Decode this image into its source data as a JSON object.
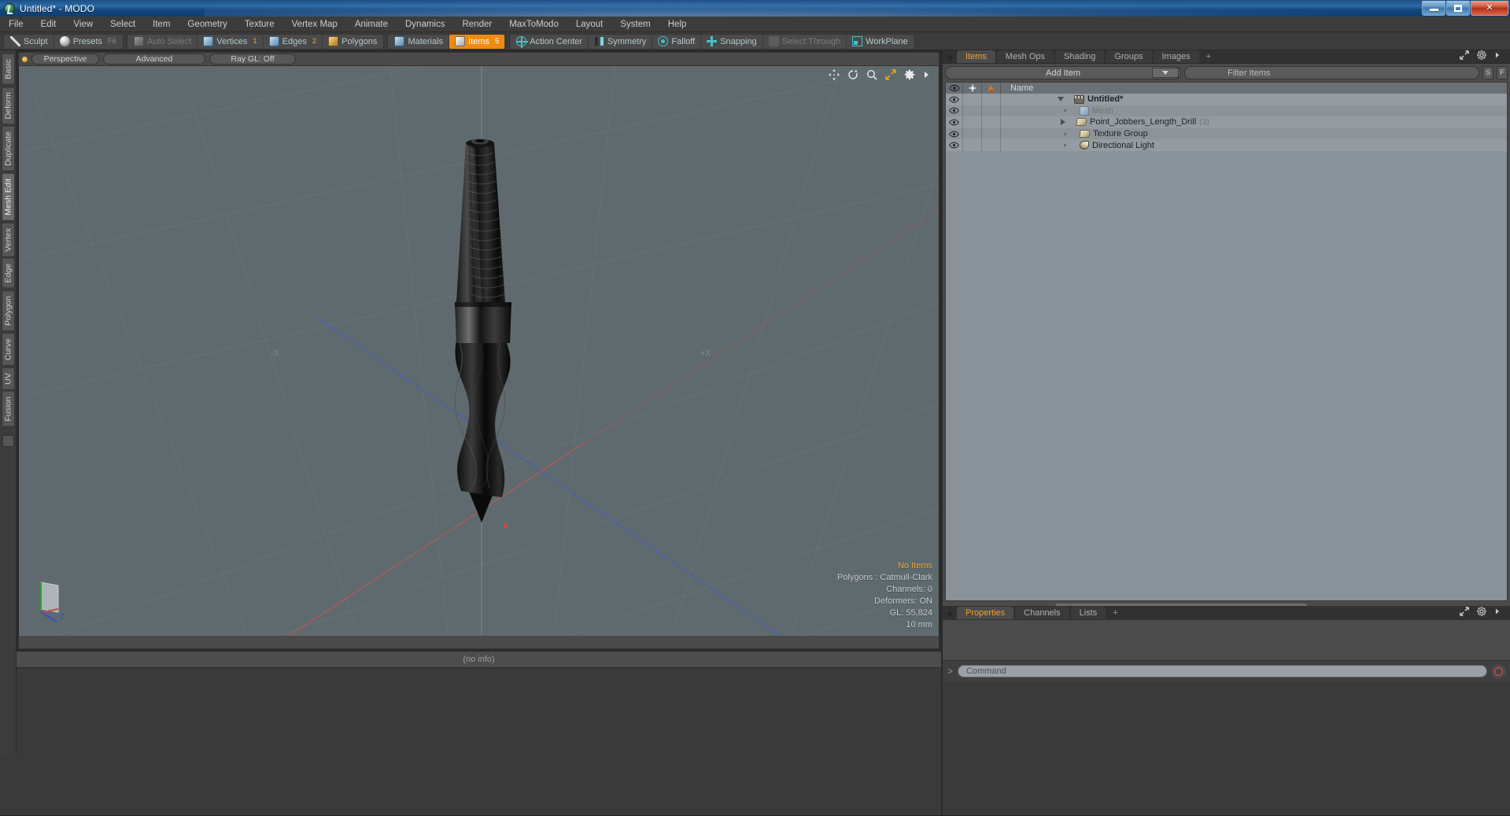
{
  "window": {
    "title": "Untitled* - MODO",
    "app_icon": "modo-logo-icon",
    "minimize_label": "Minimize",
    "maximize_label": "Restore",
    "close_label": "Close"
  },
  "menubar": {
    "items": [
      "File",
      "Edit",
      "View",
      "Select",
      "Item",
      "Geometry",
      "Texture",
      "Vertex Map",
      "Animate",
      "Dynamics",
      "Render",
      "MaxToModo",
      "Layout",
      "System",
      "Help"
    ]
  },
  "toolbar": {
    "group1": [
      {
        "label": "Sculpt",
        "icon": "pencil-icon",
        "num": "",
        "state": "normal"
      },
      {
        "label": "Presets",
        "icon": "sphere-icon",
        "num": "F6",
        "state": "normal"
      }
    ],
    "group2": [
      {
        "label": "Auto Select",
        "icon": "cube-grey-icon",
        "num": "",
        "state": "dim"
      },
      {
        "label": "Vertices",
        "icon": "cube-blue-icon",
        "num": "1",
        "state": "normal"
      },
      {
        "label": "Edges",
        "icon": "cube-blue-icon",
        "num": "2",
        "state": "normal"
      },
      {
        "label": "Polygons",
        "icon": "cube-gold-icon",
        "num": "",
        "state": "normal"
      }
    ],
    "group3": [
      {
        "label": "Materials",
        "icon": "cube-blue-icon",
        "num": "",
        "state": "normal"
      },
      {
        "label": "Items",
        "icon": "cube-white-icon",
        "num": "5",
        "state": "active"
      }
    ],
    "group4": [
      {
        "label": "Action Center",
        "icon": "action-center-icon",
        "num": "",
        "state": "normal"
      },
      {
        "label": "Symmetry",
        "icon": "symmetry-icon",
        "num": "",
        "state": "normal"
      },
      {
        "label": "Falloff",
        "icon": "falloff-icon",
        "num": "",
        "state": "normal"
      },
      {
        "label": "Snapping",
        "icon": "snapping-icon",
        "num": "",
        "state": "normal"
      },
      {
        "label": "Select Through",
        "icon": "select-through-icon",
        "num": "",
        "state": "dim"
      },
      {
        "label": "WorkPlane",
        "icon": "workplane-icon",
        "num": "",
        "state": "normal"
      }
    ]
  },
  "left_tool_tabs": {
    "items": [
      "Basic",
      "Deform",
      "Duplicate",
      "Mesh Edit",
      "Vertex",
      "Edge",
      "Polygon",
      "Curve",
      "UV",
      "Fusion"
    ],
    "active": "Mesh Edit"
  },
  "viewport": {
    "header": {
      "dot": "viewport-indicator",
      "view_mode": "Perspective",
      "shading": "Advanced",
      "raygl": "Ray GL: Off"
    },
    "gizmos": [
      "pan-icon",
      "rotate-icon",
      "zoom-icon",
      "fit-icon",
      "gear-icon",
      "chevron-right-icon"
    ],
    "hud": {
      "selection": "No Items",
      "polygons": "Polygons : Catmull-Clark",
      "channels": "Channels: 0",
      "deformers": "Deformers: ON",
      "gl": "GL: 55,824",
      "grid": "10 mm"
    },
    "axis_gizmo": {
      "x": "X",
      "y": "Y",
      "z": "Z"
    },
    "info_bar": "(no info)",
    "background_color": "#5e6a6e",
    "model_name": "Point_Jobbers_Length_Drill"
  },
  "right_panel": {
    "tabs": [
      {
        "label": "Items",
        "active": true
      },
      {
        "label": "Mesh Ops",
        "active": false
      },
      {
        "label": "Shading",
        "active": false
      },
      {
        "label": "Groups",
        "active": false
      },
      {
        "label": "Images",
        "active": false
      },
      {
        "label": "+",
        "active": false
      }
    ],
    "controls": {
      "add_item": "Add Item",
      "add_item_arrow": "chevron-down-icon",
      "filter_placeholder": "Filter Items",
      "filter_value": "Filter Items",
      "btn_s": "S",
      "btn_f": "F"
    },
    "tree_headers": {
      "eye": "visibility-icon",
      "lock": "lock-icon",
      "render": "render-icon",
      "name": "Name"
    },
    "tree_rows": [
      {
        "name": "Untitled*",
        "icon": "scene-icon",
        "twisty": "down",
        "indent": 0,
        "count": "",
        "dim": false,
        "bold": true
      },
      {
        "name": "Mesh",
        "icon": "mesh-icon",
        "twisty": "dot",
        "indent": 1,
        "count": "",
        "dim": true,
        "bold": false
      },
      {
        "name": "Point_Jobbers_Length_Drill",
        "icon": "folder-icon",
        "twisty": "right",
        "indent": 1,
        "count": "(3)",
        "dim": false,
        "bold": false
      },
      {
        "name": "Texture Group",
        "icon": "folder-icon",
        "twisty": "dot",
        "indent": 1,
        "count": "",
        "dim": false,
        "bold": false
      },
      {
        "name": "Directional Light",
        "icon": "light-icon",
        "twisty": "dot",
        "indent": 1,
        "count": "",
        "dim": false,
        "bold": false
      }
    ],
    "panel_icons": [
      "expand-icon",
      "gear-icon",
      "chevron-right-icon"
    ]
  },
  "bottom_panel": {
    "tabs": [
      {
        "label": "Properties",
        "active": true
      },
      {
        "label": "Channels",
        "active": false
      },
      {
        "label": "Lists",
        "active": false
      },
      {
        "label": "+",
        "active": false
      }
    ],
    "panel_icons": [
      "expand-icon",
      "gear-icon",
      "chevron-right-icon"
    ],
    "command": {
      "prompt": ">",
      "placeholder": "Command",
      "record_button": "record-icon"
    }
  },
  "colors": {
    "accent_orange": "#f08a12",
    "tab_orange": "#f3a02a",
    "teal_icon": "#46c0c8",
    "viewport_bg": "#5e6a6e",
    "panel_bg": "#4b4b4b",
    "chrome_bg": "#3c3c3c",
    "tree_bg": "#8a9299"
  }
}
